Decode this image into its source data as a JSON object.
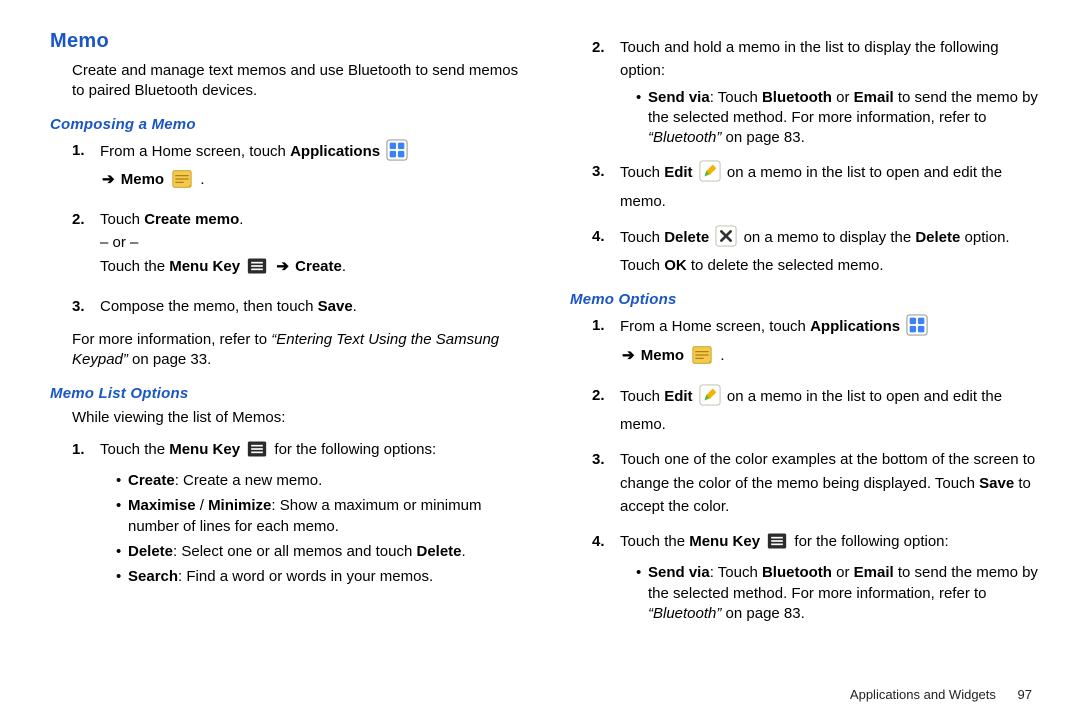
{
  "title": "Memo",
  "intro": "Create and manage text memos and use Bluetooth to send memos to paired Bluetooth devices.",
  "sec1": {
    "heading": "Composing a Memo",
    "s1a": "From a Home screen, touch ",
    "apps": "Applications",
    "memo": "Memo",
    "s2a": "Touch ",
    "create_memo": "Create memo",
    "or": "– or –",
    "s2b_a": "Touch the ",
    "menu_key": "Menu Key",
    "create": "Create",
    "s3a": "Compose the memo, then touch ",
    "save": "Save",
    "more_a": "For more information, refer to ",
    "more_ref": "“Entering Text Using the Samsung Keypad”",
    "more_b": "  on page 33."
  },
  "sec2": {
    "heading": "Memo List Options",
    "intro": "While viewing the list of Memos:",
    "s1": "Touch the ",
    "menu_key": "Menu Key",
    "s1b": "  for the following options:",
    "b1a": "Create",
    "b1b": ": Create a new memo.",
    "b2a": "Maximise",
    "b2m": " / ",
    "b2a2": "Minimize",
    "b2b": ": Show a maximum or minimum number of lines for each memo.",
    "b3a": "Delete",
    "b3b": ": Select one or all memos and touch ",
    "b3c": "Delete",
    "b4a": "Search",
    "b4b": ": Find a word or words in your memos."
  },
  "col2": {
    "s2": "Touch and hold a memo in the list to display the following option:",
    "b1a": "Send via",
    "b1b": ": Touch ",
    "bt": "Bluetooth",
    "b1c": " or ",
    "email": "Email",
    "b1d": " to send the memo by the selected method. For more information, refer to ",
    "ref": "“Bluetooth”",
    "b1e": "  on page 83.",
    "s3a": "Touch ",
    "edit": "Edit",
    "s3b": "  on a memo in the list to open and edit the memo.",
    "s4a": "Touch ",
    "delete": "Delete",
    "s4b": "  on a memo to display the ",
    "s4c": " option. Touch ",
    "ok": "OK",
    "s4d": " to delete the selected memo."
  },
  "sec3": {
    "heading": "Memo Options",
    "s1a": "From a Home screen, touch ",
    "apps": "Applications",
    "memo": "Memo",
    "s2a": "Touch ",
    "edit": "Edit",
    "s2b": "  on a memo in the list to open and edit the memo.",
    "s3": "Touch one of the color examples at the bottom of the screen to change the color of the memo being displayed. Touch ",
    "save": "Save",
    "s3b": " to accept the color.",
    "s4a": "Touch the ",
    "menu_key": "Menu Key",
    "s4b": "  for the following option:",
    "b1a": "Send via",
    "b1b": ": Touch ",
    "bt": "Bluetooth",
    "b1c": " or ",
    "email": "Email",
    "b1d": " to send the memo by the selected method. For more information, refer to ",
    "ref": "“Bluetooth”",
    "b1e": "  on page 83."
  },
  "footer": {
    "section": "Applications and Widgets",
    "page": "97"
  }
}
